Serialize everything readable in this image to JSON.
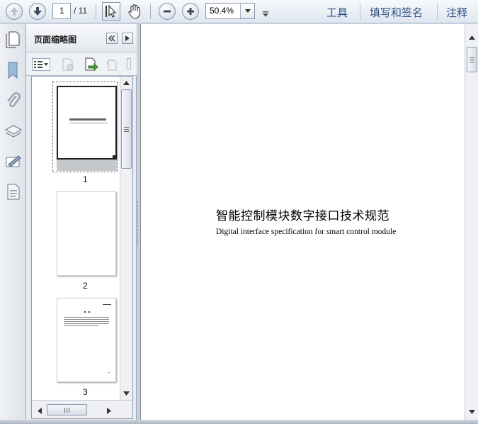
{
  "toolbar": {
    "current_page": "1",
    "total_pages": "/ 11",
    "zoom": "50.4%",
    "tools_label": "工具",
    "fill_sign_label": "填写和签名",
    "comment_label": "注释"
  },
  "panel": {
    "title": "页面缩略图"
  },
  "thumbnails": [
    {
      "label": "1"
    },
    {
      "label": "2"
    },
    {
      "label": "3"
    }
  ],
  "document": {
    "title": "智能控制模块数字接口技术规范",
    "subtitle": "Digital interface specification for smart control module"
  },
  "icons": [
    "prev-page-icon",
    "next-page-icon",
    "select-tool-icon",
    "hand-tool-icon",
    "zoom-out-icon",
    "zoom-in-icon",
    "bookmark-icon",
    "attachment-icon",
    "layers-icon",
    "signature-icon",
    "page-icon"
  ]
}
